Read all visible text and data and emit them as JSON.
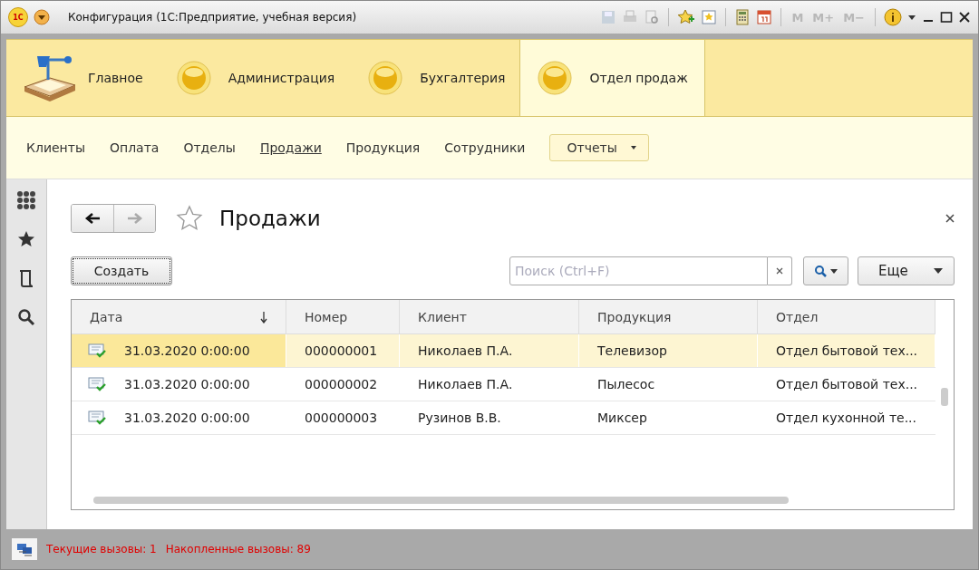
{
  "window": {
    "logo_text": "1С",
    "title": "Конфигурация  (1С:Предприятие, учебная версия)",
    "memory_buttons": [
      "M",
      "M+",
      "M−"
    ]
  },
  "sections": [
    {
      "label": "Главное",
      "kind": "home",
      "selected": false
    },
    {
      "label": "Администрация",
      "kind": "orb",
      "selected": false
    },
    {
      "label": "Бухгалтерия",
      "kind": "orb",
      "selected": false
    },
    {
      "label": "Отдел продаж",
      "kind": "orb",
      "selected": true
    }
  ],
  "nav": {
    "items": [
      {
        "label": "Клиенты",
        "selected": false
      },
      {
        "label": "Оплата",
        "selected": false
      },
      {
        "label": "Отделы",
        "selected": false
      },
      {
        "label": "Продажи",
        "selected": true
      },
      {
        "label": "Продукция",
        "selected": false
      },
      {
        "label": "Сотрудники",
        "selected": false
      }
    ],
    "reports_button": "Отчеты"
  },
  "page": {
    "title": "Продажи",
    "create_button": "Создать",
    "search": {
      "placeholder": "Поиск (Ctrl+F)"
    },
    "more_button": "Еще"
  },
  "table": {
    "columns": [
      {
        "label": "Дата",
        "sorted": true
      },
      {
        "label": "Номер",
        "sorted": false
      },
      {
        "label": "Клиент",
        "sorted": false
      },
      {
        "label": "Продукция",
        "sorted": false
      },
      {
        "label": "Отдел",
        "sorted": false
      }
    ],
    "rows": [
      {
        "cells": [
          "31.03.2020 0:00:00",
          "000000001",
          "Николаев П.А.",
          "Телевизор",
          "Отдел бытовой тех..."
        ],
        "selected": true
      },
      {
        "cells": [
          "31.03.2020 0:00:00",
          "000000002",
          "Николаев П.А.",
          "Пылесос",
          "Отдел бытовой тех..."
        ],
        "selected": false
      },
      {
        "cells": [
          "31.03.2020 0:00:00",
          "000000003",
          "Рузинов В.В.",
          "Миксер",
          "Отдел кухонной те..."
        ],
        "selected": false
      }
    ]
  },
  "status_bar": {
    "current_calls": "Текущие вызовы: 1",
    "accumulated_calls": "Накопленные вызовы: 89"
  }
}
